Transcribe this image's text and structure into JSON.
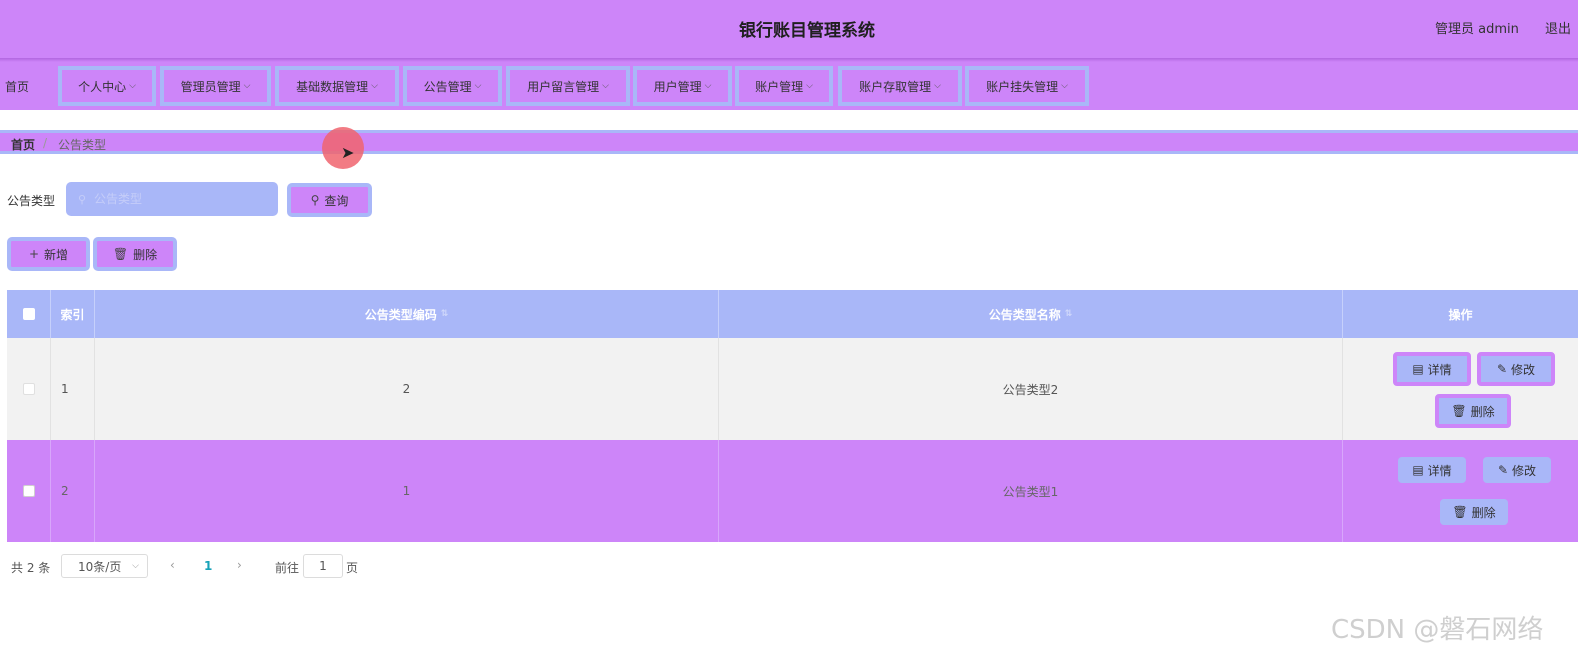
{
  "header": {
    "title": "银行账目管理系统",
    "user": "管理员 admin",
    "logout": "退出"
  },
  "nav": {
    "items": [
      {
        "label": "首页"
      },
      {
        "label": "个人中心"
      },
      {
        "label": "管理员管理"
      },
      {
        "label": "基础数据管理"
      },
      {
        "label": "公告管理"
      },
      {
        "label": "用户留言管理"
      },
      {
        "label": "用户管理"
      },
      {
        "label": "账户管理"
      },
      {
        "label": "账户存取管理"
      },
      {
        "label": "账户挂失管理"
      }
    ]
  },
  "breadcrumb": {
    "home": "首页",
    "separator": "/",
    "current": "公告类型"
  },
  "search": {
    "label": "公告类型",
    "placeholder": "公告类型",
    "query_button": "查询"
  },
  "actions": {
    "add": "新增",
    "delete": "删除"
  },
  "table": {
    "columns": [
      "索引",
      "公告类型编码",
      "公告类型名称",
      "操作"
    ],
    "rows": [
      {
        "index": "1",
        "code": "2",
        "name": "公告类型2"
      },
      {
        "index": "2",
        "code": "1",
        "name": "公告类型1"
      }
    ],
    "row_actions": {
      "detail": "详情",
      "edit": "修改",
      "delete": "删除"
    }
  },
  "pagination": {
    "total": "共 2 条",
    "page_size": "10条/页",
    "current_page": "1",
    "goto_label": "前往",
    "goto_value": "1",
    "page_label": "页"
  },
  "watermark": "CSDN @磐石网络",
  "colors": {
    "accent_purple": "#cd85f9",
    "accent_blue": "#a9b7f8"
  }
}
